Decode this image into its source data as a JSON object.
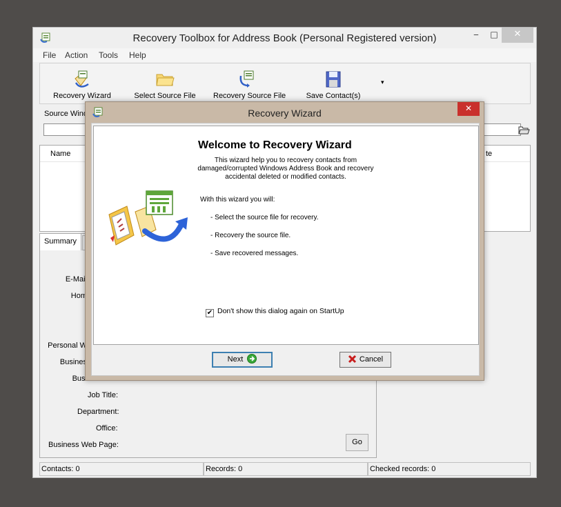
{
  "window": {
    "title": "Recovery Toolbox for Address Book (Personal Registered version)",
    "minimize": "‒",
    "maximize": "□",
    "close": "✕"
  },
  "menu": [
    "File",
    "Action",
    "Tools",
    "Help"
  ],
  "toolbar": {
    "recovery_wizard": "Recovery Wizard",
    "select_source": "Select Source File",
    "recovery_source": "Recovery Source File",
    "save_contacts": "Save Contact(s)",
    "dropdown": "▾"
  },
  "source": {
    "label": "Source Windows Address Book",
    "value": ""
  },
  "list": {
    "col_name": "Name",
    "col_date": "te"
  },
  "details": {
    "tab_summary": "Summary",
    "labels": {
      "email": "E-Mail",
      "home": "Hom",
      "personal_web": "Personal W",
      "business": "Busines",
      "business2": "Busi",
      "job_title": "Job Title:",
      "department": "Department:",
      "office": "Office:",
      "business_web": "Business Web Page:"
    },
    "go_button": "Go"
  },
  "status": {
    "contacts": "Contacts: 0",
    "records": "Records: 0",
    "checked": "Checked records: 0"
  },
  "dialog": {
    "title": "Recovery Wizard",
    "close": "✕",
    "heading": "Welcome to Recovery Wizard",
    "intro": "This wizard help you to recovery contacts from damaged/corrupted Windows Address Book and recovery accidental deleted or modified contacts.",
    "with_wizard": "With this wizard you will:",
    "steps": [
      "- Select the source file for recovery.",
      "- Recovery the source file.",
      "- Save recovered messages."
    ],
    "dont_show": "Don't show this dialog again on StartUp",
    "dont_show_checked": true,
    "checkmark": "✔",
    "next": "Next",
    "cancel": "Cancel"
  },
  "colors": {
    "dialog_frame": "#c9b9a7",
    "close_red": "#c9302c",
    "desktop": "#4f4c4a",
    "next_focus": "#3c7fb1"
  }
}
